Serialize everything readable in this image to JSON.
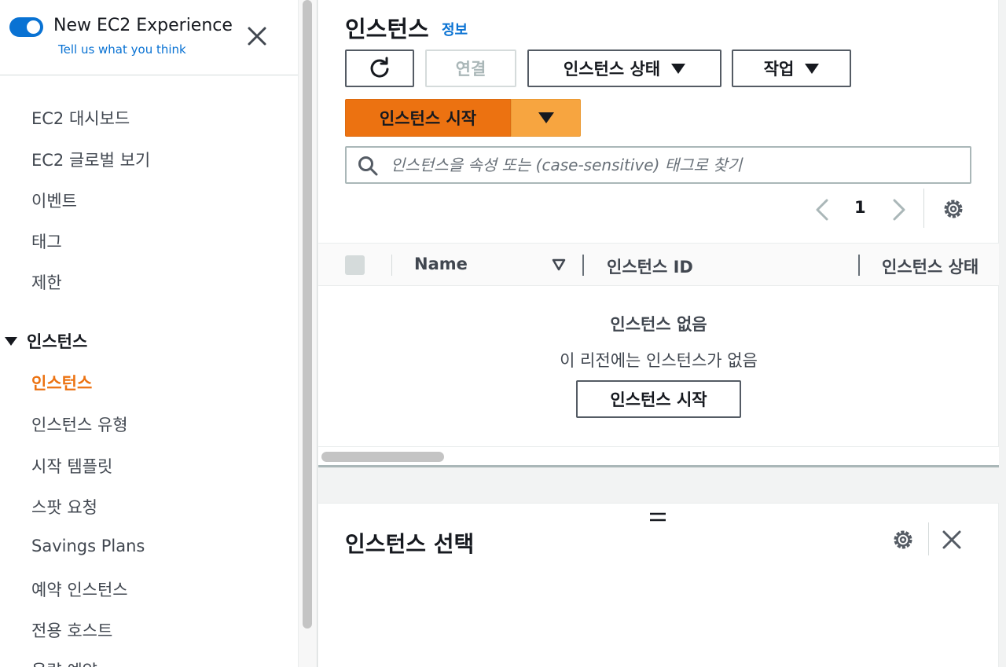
{
  "sidebar": {
    "experience_title": "New EC2 Experience",
    "feedback_link": "Tell us what you think",
    "toggle_on": true,
    "items": [
      {
        "label": "EC2 대시보드"
      },
      {
        "label": "EC2 글로벌 보기"
      },
      {
        "label": "이벤트"
      },
      {
        "label": "태그"
      },
      {
        "label": "제한"
      }
    ],
    "section": {
      "label": "인스턴스",
      "items": [
        {
          "label": "인스턴스",
          "active": true
        },
        {
          "label": "인스턴스 유형"
        },
        {
          "label": "시작 템플릿"
        },
        {
          "label": "스팟 요청"
        },
        {
          "label": "Savings Plans"
        },
        {
          "label": "예약 인스턴스"
        },
        {
          "label": "전용 호스트"
        },
        {
          "label": "용량 예약"
        }
      ]
    }
  },
  "main": {
    "title": "인스턴스",
    "info_link": "정보",
    "toolbar": {
      "connect_label": "연결",
      "instance_state_label": "인스턴스 상태",
      "actions_label": "작업",
      "launch_label": "인스턴스 시작"
    },
    "search": {
      "placeholder": "인스턴스을 속성 또는 (case-sensitive) 태그로 찾기"
    },
    "pagination": {
      "current_page": "1"
    },
    "table": {
      "columns": [
        "Name",
        "인스턴스 ID",
        "인스턴스 상태"
      ]
    },
    "empty_state": {
      "title": "인스턴스 없음",
      "description": "이 리전에는 인스턴스가 없음",
      "button_label": "인스턴스 시작"
    }
  },
  "split_panel": {
    "drag_glyph": "=",
    "title": "인스턴스 선택"
  },
  "colors": {
    "accent_blue": "#0972d3",
    "primary_orange": "#ec7211",
    "split_orange": "#f7a540",
    "active_nav": "#ec7211"
  }
}
